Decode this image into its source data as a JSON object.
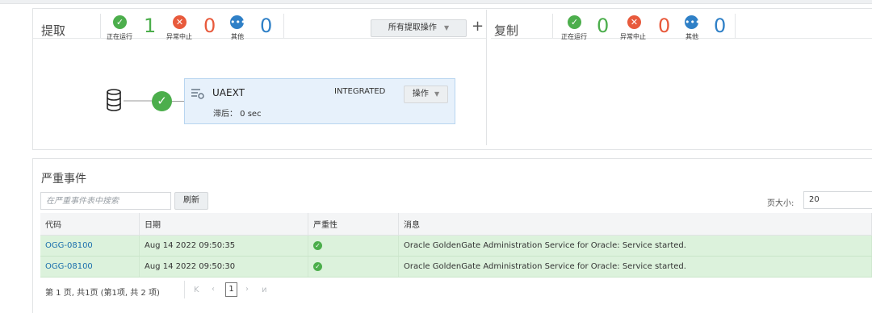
{
  "extract": {
    "title": "提取",
    "stats": [
      {
        "label": "正在运行",
        "count": "1",
        "icon": "check-icon",
        "color": "#4cae4c"
      },
      {
        "label": "异常中止",
        "count": "0",
        "icon": "x-icon",
        "color": "#e85a3c"
      },
      {
        "label": "其他",
        "count": "0",
        "icon": "more-icon",
        "color": "#2f80c7"
      }
    ],
    "all_ops_label": "所有提取操作",
    "add_symbol": "+"
  },
  "replicat": {
    "title": "复制",
    "stats": [
      {
        "label": "正在运行",
        "count": "0",
        "icon": "check-icon",
        "color": "#4cae4c"
      },
      {
        "label": "异常中止",
        "count": "0",
        "icon": "x-icon",
        "color": "#e85a3c"
      },
      {
        "label": "其他",
        "count": "0",
        "icon": "more-icon",
        "color": "#2f80c7"
      }
    ]
  },
  "process_card": {
    "name": "UAEXT",
    "type": "INTEGRATED",
    "lag": "滞后： 0 sec",
    "ops_label": "操作"
  },
  "events": {
    "title": "严重事件",
    "search_placeholder": "在严重事件表中搜索",
    "refresh_label": "刷新",
    "page_size_label": "页大小:",
    "page_size_value": "20",
    "columns": [
      "代码",
      "日期",
      "严重性",
      "消息"
    ],
    "rows": [
      {
        "code": "OGG-08100",
        "date": "Aug 14 2022 09:50:35",
        "message": "Oracle GoldenGate Administration Service for Oracle: Service started."
      },
      {
        "code": "OGG-08100",
        "date": "Aug 14 2022 09:50:30",
        "message": "Oracle GoldenGate Administration Service for Oracle: Service started."
      }
    ],
    "pager_text": "第 1 页, 共1页 (第1项, 共 2 项)",
    "current_page": "1"
  },
  "colors": {
    "success": "#4cae4c",
    "error": "#e85a3c",
    "info": "#2f80c7",
    "link": "#1b6fad",
    "row_bg": "#dcf2dc",
    "card_bg": "#e7f1fb"
  }
}
